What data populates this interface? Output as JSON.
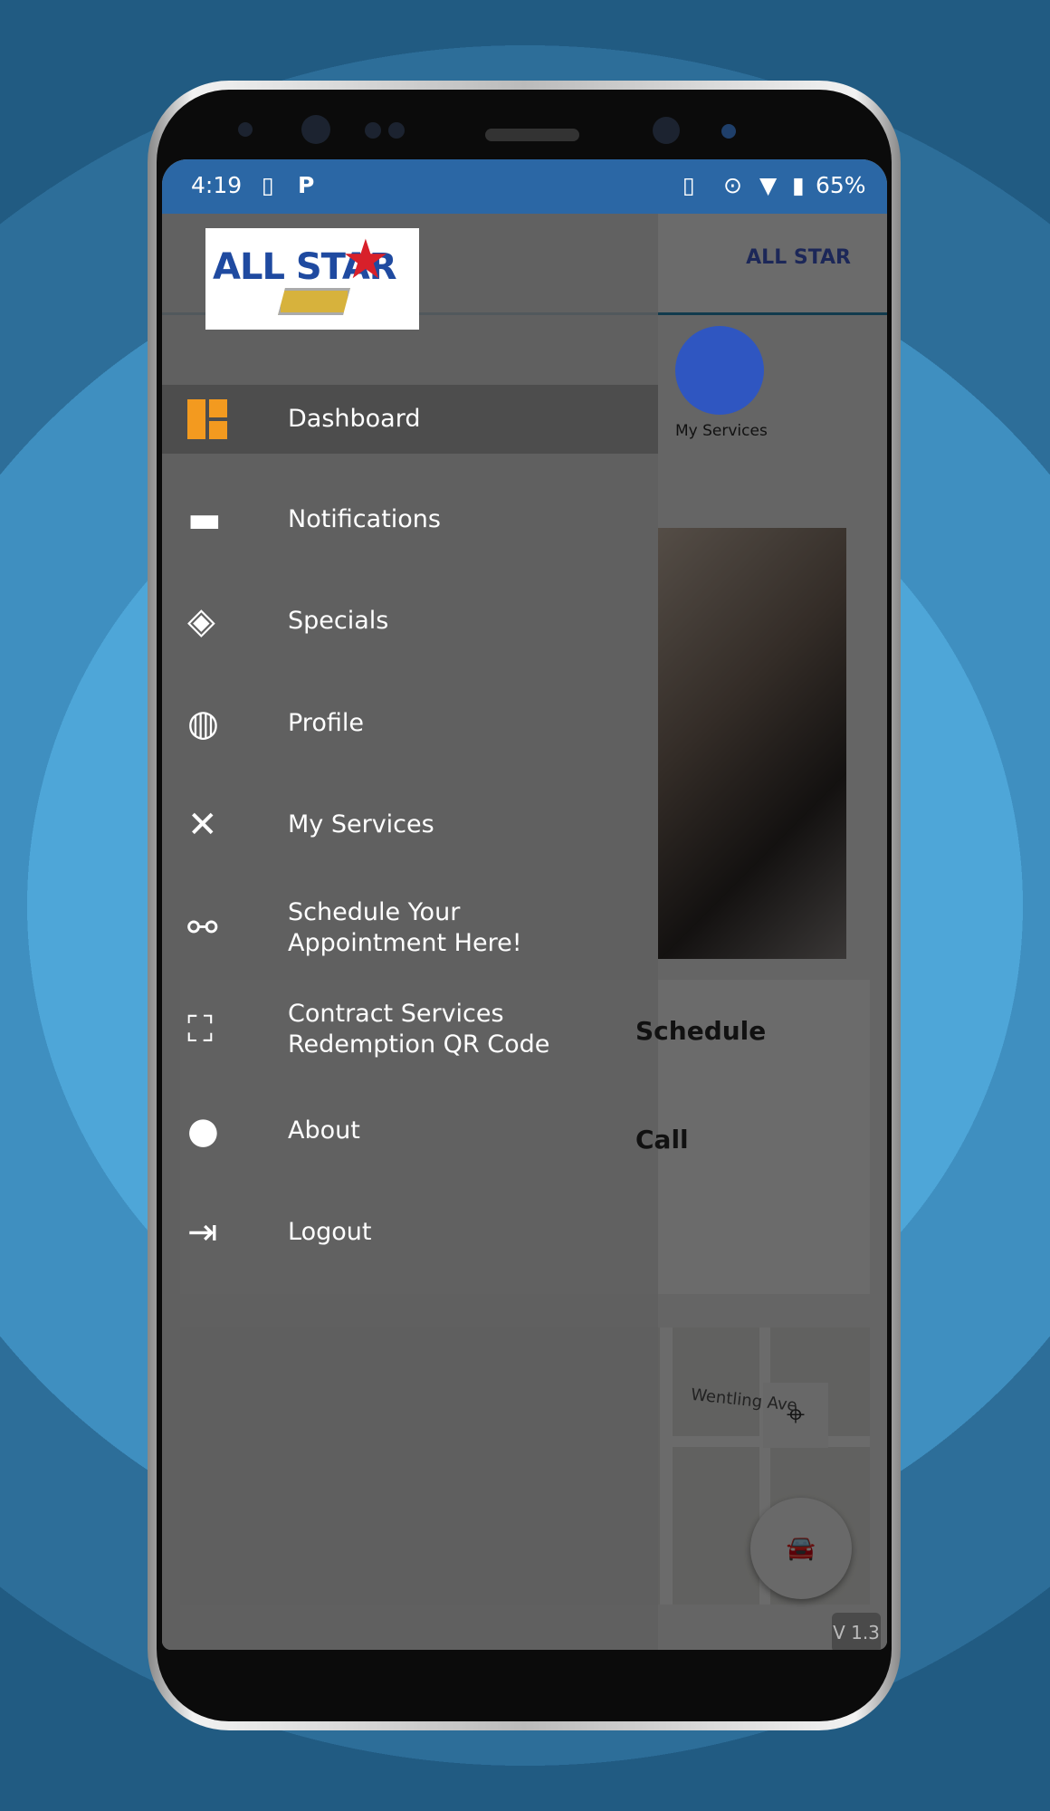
{
  "status_bar": {
    "time": "4:19",
    "battery": "65%",
    "icons": [
      "phone-sync-icon",
      "parking-icon",
      "vibrate-icon",
      "location-icon",
      "wifi-icon",
      "battery-charging-icon"
    ]
  },
  "colors": {
    "accent": "#2f56c1",
    "status_bar": "#2b67a5",
    "dashboard_icon": "#f39a1f"
  },
  "drawer": {
    "logo_text": "ALL STAR",
    "items": [
      {
        "label": "Dashboard",
        "icon": "dashboard-grid-icon",
        "active": true
      },
      {
        "label": "Notifications",
        "icon": "chat-bubble-icon"
      },
      {
        "label": "Specials",
        "icon": "price-tag-icon"
      },
      {
        "label": "Profile",
        "icon": "helmet-icon"
      },
      {
        "label": "My Services",
        "icon": "tools-icon"
      },
      {
        "label": "Schedule Your Appointment Here!",
        "icon": "link-icon"
      },
      {
        "label": "Contract Services Redemption QR Code",
        "icon": "qr-scan-icon"
      },
      {
        "label": "About",
        "icon": "lightbulb-icon"
      },
      {
        "label": "Logout",
        "icon": "logout-icon"
      }
    ]
  },
  "background_app": {
    "header_logo": "ALL STAR",
    "tab_my_services": "My Services",
    "schedule": "Schedule",
    "call": "Call",
    "map_street": "Wentling Ave",
    "version": "V 1.3"
  }
}
